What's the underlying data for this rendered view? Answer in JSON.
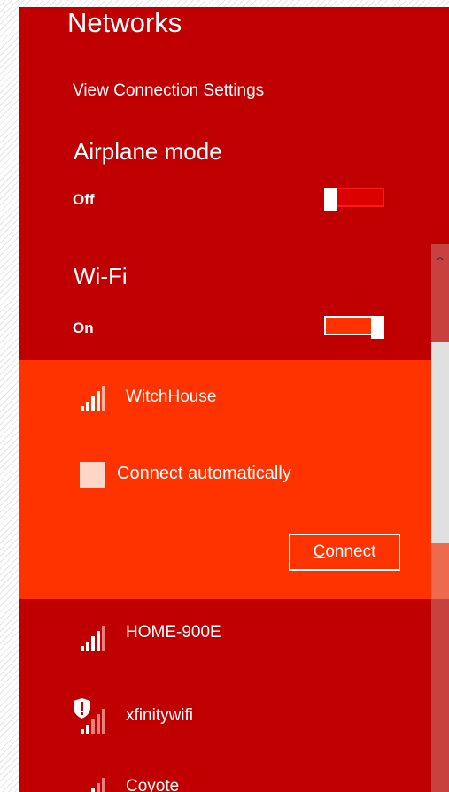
{
  "header": {
    "title": "Networks",
    "view_settings_label": "View Connection Settings"
  },
  "airplane": {
    "label": "Airplane mode",
    "state": "Off"
  },
  "wifi": {
    "label": "Wi-Fi",
    "state": "On"
  },
  "selected_network": {
    "name": "WitchHouse",
    "connect_automatically_label": "Connect automatically",
    "connect_button_first": "C",
    "connect_button_rest": "onnect"
  },
  "networks": [
    {
      "name": "HOME-900E",
      "secured": false
    },
    {
      "name": "xfinitywifi",
      "secured": false
    },
    {
      "name": "Coyote",
      "secured": false
    }
  ],
  "icons": {
    "signal": "wifi-signal-icon",
    "warning_shield": "shield-warning-icon",
    "scroll_up": "chevron-up-icon"
  },
  "colors": {
    "panel_bg": "#c00000",
    "selected_bg": "#ff3300",
    "toggle_on": "#ff3300",
    "scroll_thumb": "#e0e0e0"
  }
}
